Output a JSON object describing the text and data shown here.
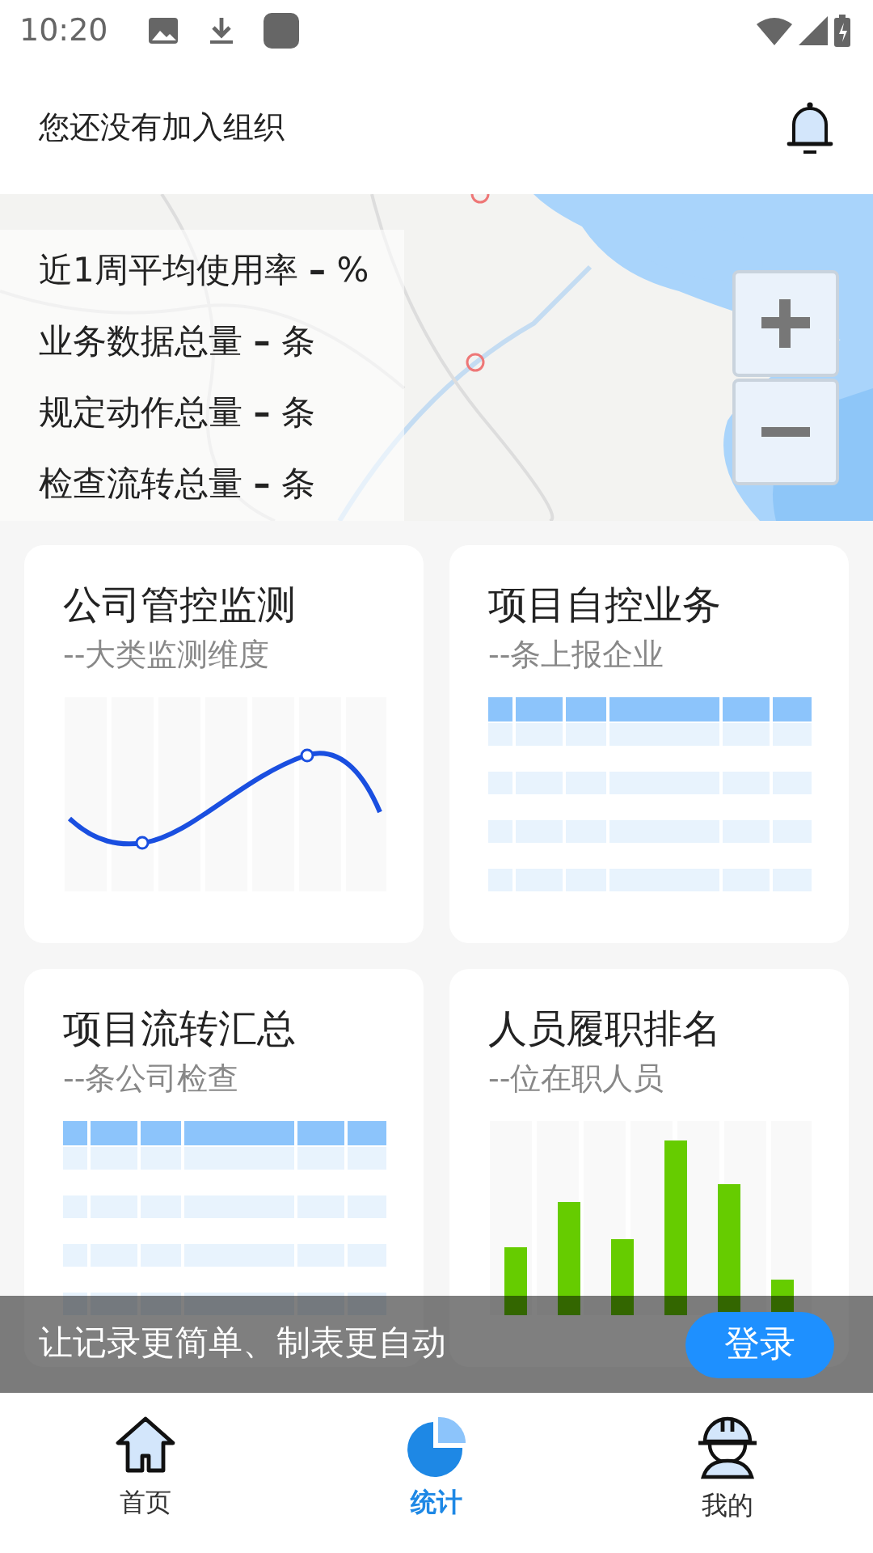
{
  "status_bar": {
    "time": "10:20"
  },
  "header": {
    "title": "您还没有加入组织"
  },
  "map": {
    "kind": "picture",
    "stats": [
      "近1周平均使用率 **–** %",
      "业务数据总量 **–** 条",
      "规定动作总量 **–** 条",
      "检查流转总量 **–** 条"
    ]
  },
  "cards": [
    {
      "kind": "line",
      "title": "公司管控监测",
      "subtitle": "--大类监测维度"
    },
    {
      "kind": "table",
      "title": "项目自控业务",
      "subtitle": "--条上报企业"
    },
    {
      "kind": "table",
      "title": "项目流转汇总",
      "subtitle": "--条公司检查"
    },
    {
      "kind": "bars",
      "title": "人员履职排名",
      "subtitle": "--位在职人员"
    }
  ],
  "banner": {
    "text": "让记录更简单、制表更自动",
    "button": "登录"
  },
  "nav": [
    {
      "kind": "home",
      "label": "首页",
      "selected": false
    },
    {
      "kind": "stats",
      "label": "统计",
      "selected": true
    },
    {
      "kind": "profile",
      "label": "我的",
      "selected": false
    }
  ]
}
